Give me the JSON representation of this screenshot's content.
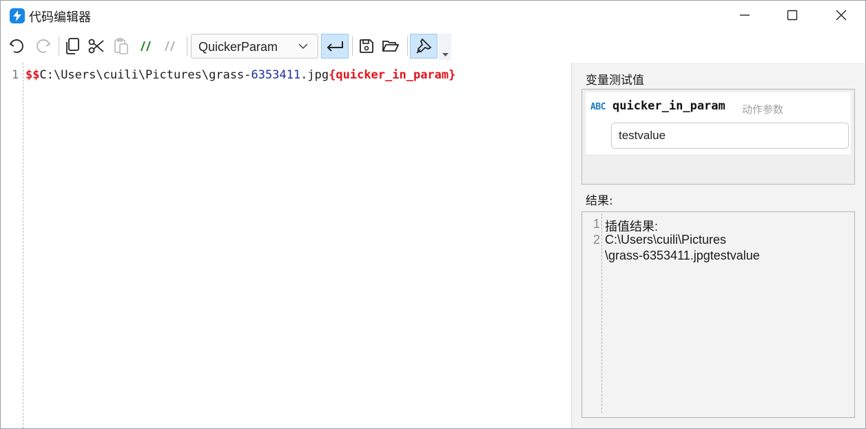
{
  "window": {
    "title": "代码编辑器"
  },
  "toolbar": {
    "language_select": "QuickerParam",
    "buttons": [
      {
        "name": "undo-icon",
        "enabled": true
      },
      {
        "name": "redo-icon",
        "enabled": false
      },
      {
        "name": "copy-icon",
        "enabled": true
      },
      {
        "name": "cut-icon",
        "enabled": true
      },
      {
        "name": "paste-icon",
        "enabled": false
      },
      {
        "name": "comment-icon",
        "enabled": true
      },
      {
        "name": "uncomment-icon",
        "enabled": false
      },
      {
        "name": "word-wrap-icon",
        "active": true
      },
      {
        "name": "save-icon",
        "enabled": true
      },
      {
        "name": "open-folder-icon",
        "enabled": true
      },
      {
        "name": "pin-icon",
        "active": true
      }
    ]
  },
  "editor": {
    "line_number": "1",
    "code": {
      "prefix": "$$",
      "path_part": "C:\\Users\\cuili\\Pictures\\grass-",
      "number_part": "6353411",
      "ext_part": ".jpg",
      "param": "{quicker_in_param}"
    }
  },
  "variables": {
    "section_title": "变量测试值",
    "items": [
      {
        "type_badge": "ABC",
        "name": "quicker_in_param",
        "description": "动作参数",
        "value": "testvalue"
      }
    ]
  },
  "result": {
    "section_title": "结果:",
    "lines": [
      {
        "number": "1",
        "text": "插值结果:"
      },
      {
        "number": "2",
        "text": "C:\\Users\\cuili\\Pictures"
      },
      {
        "number": "",
        "text": "\\grass-6353411.jpgtestvalue"
      }
    ]
  },
  "colors": {
    "accent": "#1787e8",
    "active_button": "#cde6fb",
    "code_variable": "#e0141e",
    "code_number": "#1f2f9e",
    "type_badge": "#1a78c2"
  }
}
